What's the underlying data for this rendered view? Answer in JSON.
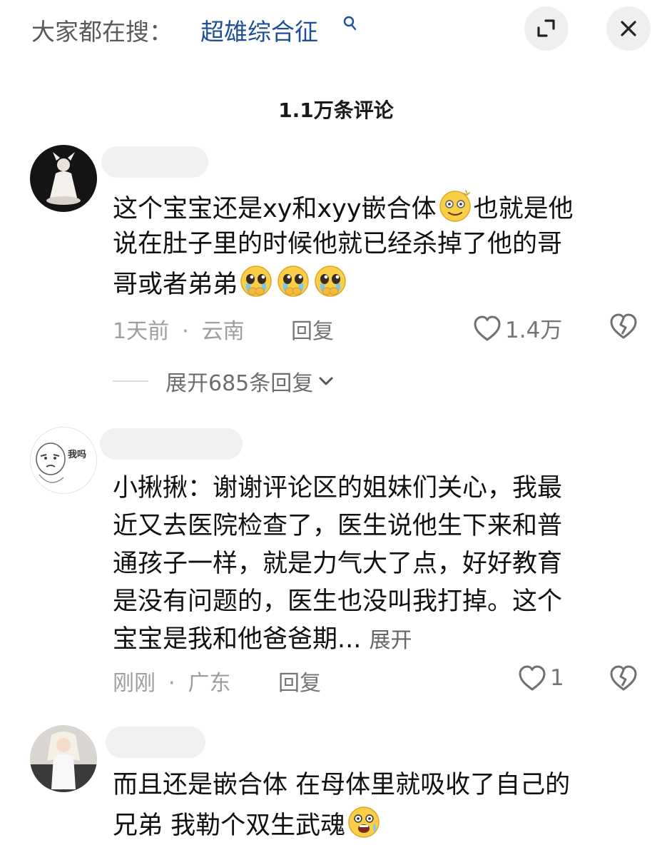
{
  "search": {
    "prefix": "大家都在搜：",
    "term": "超雄综合征"
  },
  "comment_count": "1.1万条评论",
  "comments": [
    {
      "lines": [
        "这个宝宝还是xy和xyy嵌合体",
        "也就是他",
        "说在肚子里的时候他就已经杀掉了他的哥",
        "哥或者弟弟"
      ],
      "time": "1天前",
      "location": "云南",
      "reply_label": "回复",
      "likes": "1.4万",
      "expand_replies": "展开685条回复"
    },
    {
      "lines": [
        "小揪揪：谢谢评论区的姐妹们关心，我最",
        "近又去医院检查了，医生说他生下来和普",
        "通孩子一样，就是力气大了点，好好教育",
        "是没有问题的，医生也没叫我打掉。这个",
        "宝宝是我和他爸爸期..."
      ],
      "more": "展开",
      "time": "刚刚",
      "location": "广东",
      "reply_label": "回复",
      "likes": "1",
      "avatar_text": "我吗"
    },
    {
      "lines": [
        "而且还是嵌合体 在母体里就吸收了自己的",
        "兄弟 我勒个双生武魂"
      ]
    }
  ],
  "meta_separator": "·",
  "icons": {
    "search": "search-icon",
    "expand": "expand-icon",
    "close": "close-icon",
    "like": "heart-icon",
    "dislike": "broken-heart-icon",
    "chevron": "chevron-down-icon",
    "emoji_smile": "dizzy-smile-emoji-icon",
    "emoji_cry": "pleading-crying-emoji-icon",
    "emoji_shock": "shocked-emoji-icon"
  },
  "colors": {
    "search_term": "#1f4f96",
    "meta_text": "#9e9e9e",
    "button_bg": "#efefef"
  }
}
